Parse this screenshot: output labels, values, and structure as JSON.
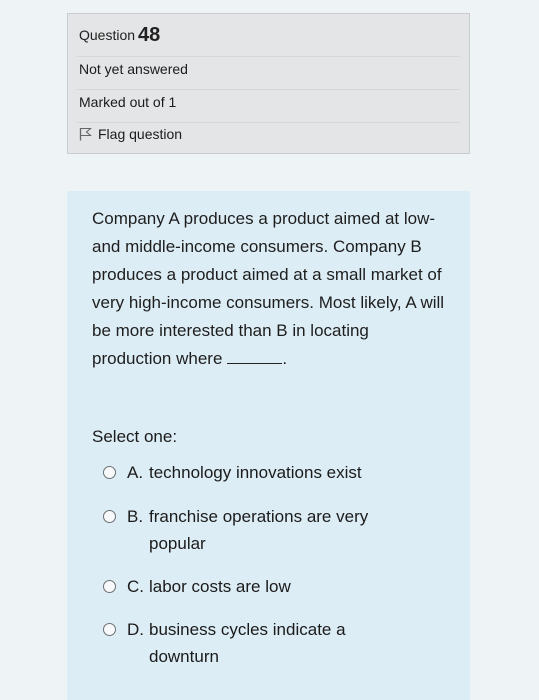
{
  "info": {
    "question_label": "Question",
    "question_number": "48",
    "state": "Not yet answered",
    "grade": "Marked out of 1",
    "flag_label": "Flag question"
  },
  "question": {
    "text": "Company A produces a product aimed at low- and middle-income consumers. Company B produces a product aimed at a small market of very high-income consumers. Most likely, A will be more interested than B in locating production where",
    "text_end": ".",
    "prompt": "Select one:",
    "options": [
      {
        "letter": "A.",
        "text": "technology innovations exist"
      },
      {
        "letter": "B.",
        "text": "franchise operations are very popular"
      },
      {
        "letter": "C.",
        "text": "labor costs are low"
      },
      {
        "letter": "D.",
        "text": "business cycles indicate a downturn"
      }
    ]
  }
}
